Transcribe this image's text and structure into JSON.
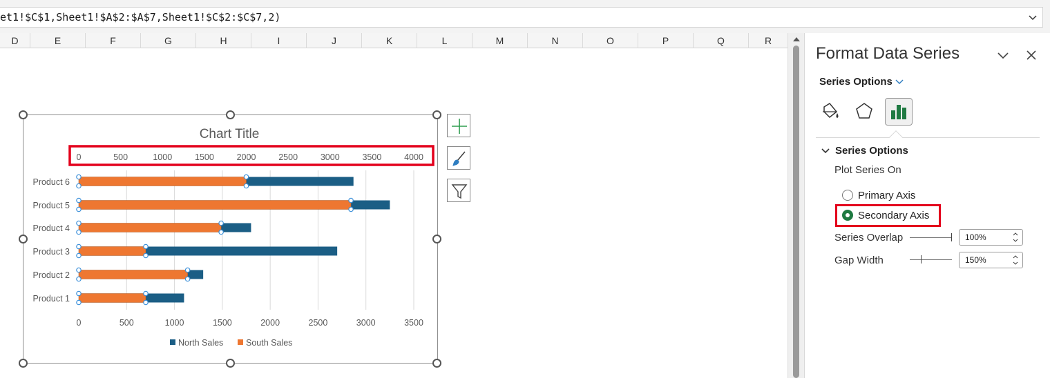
{
  "formula_bar": {
    "text": "et1!$C$1,Sheet1!$A$2:$A$7,Sheet1!$C$2:$C$7,2)"
  },
  "columns": [
    "D",
    "E",
    "F",
    "G",
    "H",
    "I",
    "J",
    "K",
    "L",
    "M",
    "N",
    "O",
    "P",
    "Q",
    "R"
  ],
  "chart_data": {
    "type": "bar",
    "orientation": "horizontal",
    "title": "Chart Title",
    "categories": [
      "Product 1",
      "Product 2",
      "Product 3",
      "Product 4",
      "Product 5",
      "Product 6"
    ],
    "series": [
      {
        "name": "North Sales",
        "color": "#1b5e85",
        "axis": "primary",
        "values": [
          1100,
          1300,
          2700,
          1800,
          3250,
          2870
        ]
      },
      {
        "name": "South Sales",
        "color": "#ee7731",
        "axis": "secondary",
        "values": [
          800,
          1300,
          800,
          1700,
          3250,
          2000
        ]
      }
    ],
    "primary_axis": {
      "min": 0,
      "max": 3500,
      "ticks": [
        "0",
        "500",
        "1000",
        "1500",
        "2000",
        "2500",
        "3000",
        "3500"
      ]
    },
    "secondary_axis": {
      "min": 0,
      "max": 4000,
      "position": "top",
      "ticks": [
        "0",
        "500",
        "1000",
        "1500",
        "2000",
        "2500",
        "3000",
        "3500",
        "4000"
      ]
    },
    "legend": {
      "position": "bottom",
      "entries": [
        "North Sales",
        "South Sales"
      ]
    },
    "selected_series": "South Sales",
    "highlight_color": "#e3001b"
  },
  "chart_buttons": [
    "plus-icon",
    "brush-icon",
    "filter-icon"
  ],
  "pane": {
    "title": "Format Data Series",
    "dropdown": "Series Options",
    "tabs": [
      "fill-line-icon",
      "effects-icon",
      "series-options-icon"
    ],
    "section_title": "Series Options",
    "plot_series_on": "Plot Series On",
    "primary_axis": "Primary Axis",
    "secondary_axis": "Secondary Axis",
    "selected_axis": "Secondary Axis",
    "overlap_label": "Series Overlap",
    "overlap_value": "100%",
    "gap_label": "Gap Width",
    "gap_value": "150%",
    "accent_color": "#1f7a42"
  }
}
